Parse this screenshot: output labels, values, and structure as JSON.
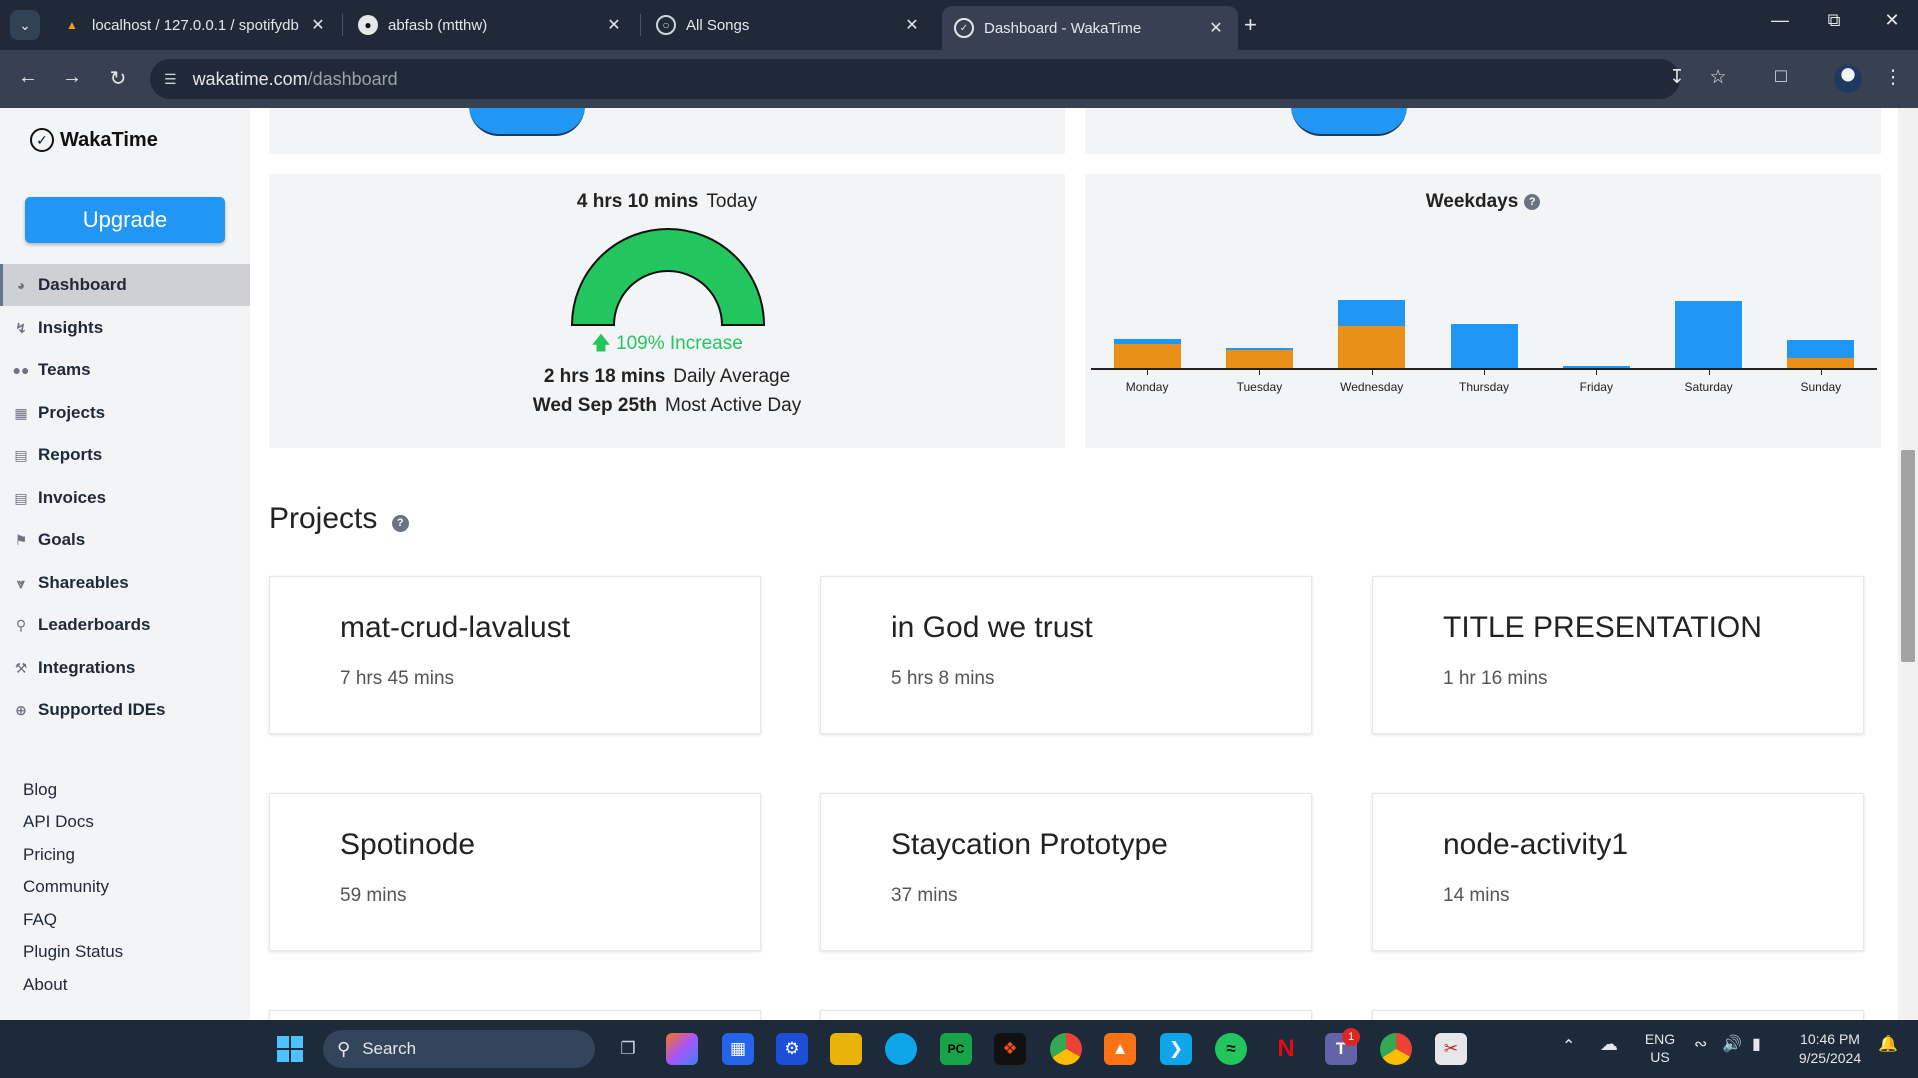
{
  "browser": {
    "tabs": [
      {
        "title": "localhost / 127.0.0.1 / spotifydb",
        "icon": "phpmyadmin-icon"
      },
      {
        "title": "abfasb (mtthw)",
        "icon": "github-icon"
      },
      {
        "title": "All Songs",
        "icon": "globe-icon"
      },
      {
        "title": "Dashboard - WakaTime",
        "icon": "wakatime-icon",
        "active": true
      }
    ],
    "url_host": "wakatime.com",
    "url_path": "/dashboard"
  },
  "sidebar": {
    "logo": "WakaTime",
    "upgrade_label": "Upgrade",
    "nav": [
      {
        "label": "Dashboard",
        "icon": "dashboard-icon",
        "active": true
      },
      {
        "label": "Insights",
        "icon": "bolt-icon"
      },
      {
        "label": "Teams",
        "icon": "users-icon"
      },
      {
        "label": "Projects",
        "icon": "grid-icon"
      },
      {
        "label": "Reports",
        "icon": "pdf-icon"
      },
      {
        "label": "Invoices",
        "icon": "document-icon"
      },
      {
        "label": "Goals",
        "icon": "flag-icon"
      },
      {
        "label": "Shareables",
        "icon": "share-icon"
      },
      {
        "label": "Leaderboards",
        "icon": "trophy-icon"
      },
      {
        "label": "Integrations",
        "icon": "wrench-icon"
      },
      {
        "label": "Supported IDEs",
        "icon": "plus-circle-icon"
      }
    ],
    "footer_links": [
      "Blog",
      "API Docs",
      "Pricing",
      "Community",
      "FAQ",
      "Plugin Status",
      "About"
    ]
  },
  "today_card": {
    "time": "4 hrs 10 mins",
    "label": "Today",
    "increase": "109% Increase",
    "daily_average_value": "2 hrs 18 mins",
    "daily_average_label": "Daily Average",
    "most_active_value": "Wed Sep 25th",
    "most_active_label": "Most Active Day",
    "gauge_color": "#22c55e"
  },
  "weekdays_card": {
    "title": "Weekdays"
  },
  "chart_data": {
    "type": "bar",
    "title": "Weekdays",
    "categories": [
      "Monday",
      "Tuesday",
      "Wednesday",
      "Thursday",
      "Friday",
      "Saturday",
      "Sunday"
    ],
    "series": [
      {
        "color": "#e8901a",
        "values": [
          0.4,
          0.3,
          0.7,
          0,
          0,
          0,
          0.17
        ]
      },
      {
        "color": "#2196f3",
        "values": [
          0.08,
          0.04,
          0.43,
          0.73,
          0.04,
          1.12,
          0.3
        ]
      }
    ],
    "stacked": true,
    "grid": false
  },
  "projects": {
    "title": "Projects",
    "items": [
      {
        "name": "mat-crud-lavalust",
        "time": "7 hrs 45 mins"
      },
      {
        "name": "in God we trust",
        "time": "5 hrs 8 mins"
      },
      {
        "name": "TITLE PRESENTATION",
        "time": "1 hr 16 mins"
      },
      {
        "name": "Spotinode",
        "time": "59 mins"
      },
      {
        "name": "Staycation Prototype",
        "time": "37 mins"
      },
      {
        "name": "node-activity1",
        "time": "14 mins"
      }
    ]
  },
  "taskbar": {
    "search_placeholder": "Search",
    "lang_top": "ENG",
    "lang_bottom": "US",
    "time": "10:46 PM",
    "date": "9/25/2024",
    "teams_badge": "1"
  }
}
